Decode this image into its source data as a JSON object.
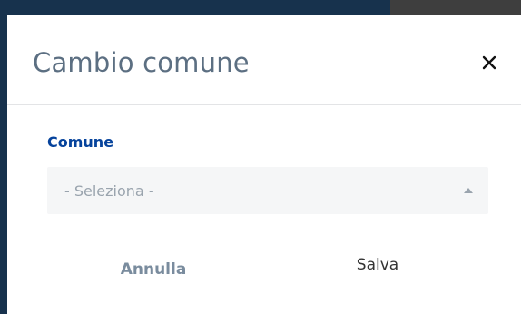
{
  "modal": {
    "title": "Cambio comune",
    "close_icon": "close-icon"
  },
  "form": {
    "field_label": "Comune",
    "select_placeholder": "- Seleziona -",
    "select_icon": "caret-up-icon"
  },
  "actions": {
    "cancel_label": "Annulla",
    "save_label": "Salva"
  },
  "colors": {
    "backdrop_blue": "#17324d",
    "backdrop_gray": "#3e3e3e",
    "title": "#5c6f82",
    "label": "#06439c",
    "select_bg": "#f5f6f7",
    "cancel_text": "#7a8c9e",
    "save_text": "#333333"
  }
}
